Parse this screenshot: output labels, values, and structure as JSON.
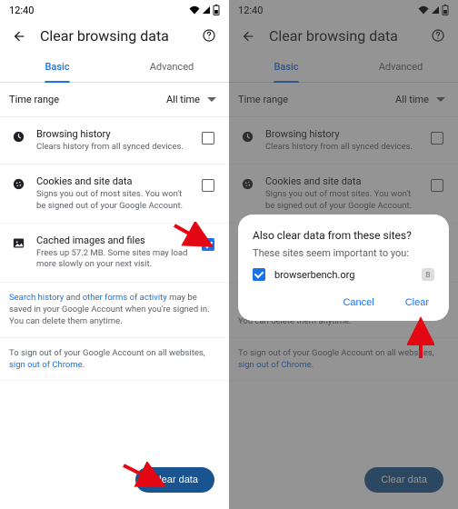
{
  "statusbar": {
    "time": "12:40"
  },
  "header": {
    "title": "Clear browsing data"
  },
  "tabs": {
    "basic": "Basic",
    "advanced": "Advanced"
  },
  "timerange": {
    "label": "Time range",
    "value": "All time"
  },
  "rows": {
    "history": {
      "title": "Browsing history",
      "desc": "Clears history from all synced devices."
    },
    "cookies": {
      "title": "Cookies and site data",
      "desc": "Signs you out of most sites. You won't be signed out of your Google Account."
    },
    "cache": {
      "title": "Cached images and files",
      "desc": "Frees up 57.2 MB. Some sites may load more slowly on your next visit."
    }
  },
  "note1": {
    "pre": "",
    "link1": "Search history",
    "mid": " and ",
    "link2": "other forms of activity",
    "post": " may be saved in your Google Account when you're signed in. You can delete them anytime."
  },
  "note2": {
    "pre": "To sign out of your Google Account on all websites, ",
    "link": "sign out of Chrome",
    "post": "."
  },
  "clearbtn": "Clear data",
  "dialog": {
    "title": "Also clear data from these sites?",
    "sub": "These sites seem important to you:",
    "site": "browserbench.org",
    "favlabel": "B",
    "cancel": "Cancel",
    "clear": "Clear"
  }
}
